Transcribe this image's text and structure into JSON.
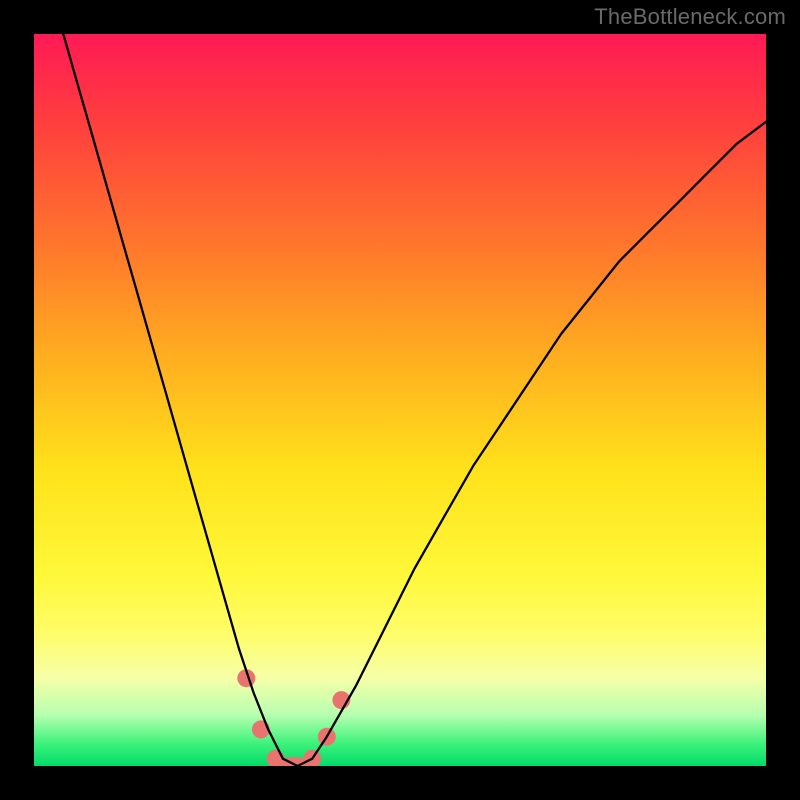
{
  "watermark": "TheBottleneck.com",
  "chart_data": {
    "type": "line",
    "title": "",
    "xlabel": "",
    "ylabel": "",
    "xlim": [
      0,
      100
    ],
    "ylim": [
      0,
      100
    ],
    "series": [
      {
        "name": "bottleneck-curve",
        "x": [
          4,
          6,
          8,
          10,
          12,
          14,
          16,
          18,
          20,
          22,
          24,
          26,
          28,
          30,
          32,
          34,
          36,
          38,
          40,
          44,
          48,
          52,
          56,
          60,
          64,
          68,
          72,
          76,
          80,
          84,
          88,
          92,
          96,
          100
        ],
        "values": [
          100,
          93,
          86,
          79,
          72,
          65,
          58,
          51,
          44,
          37,
          30,
          23,
          16,
          10,
          5,
          1,
          0,
          1,
          4,
          11,
          19,
          27,
          34,
          41,
          47,
          53,
          59,
          64,
          69,
          73,
          77,
          81,
          85,
          88
        ]
      }
    ],
    "markers": {
      "name": "highlight-dots",
      "x": [
        29,
        31,
        33,
        35,
        36,
        38,
        40,
        42
      ],
      "values": [
        12,
        5,
        1,
        0,
        0,
        1,
        4,
        9
      ]
    },
    "colors": {
      "curve": "#000000",
      "markers": "#e9746f",
      "gradient_top": "#ff1a55",
      "gradient_bottom": "#02da6a"
    }
  }
}
